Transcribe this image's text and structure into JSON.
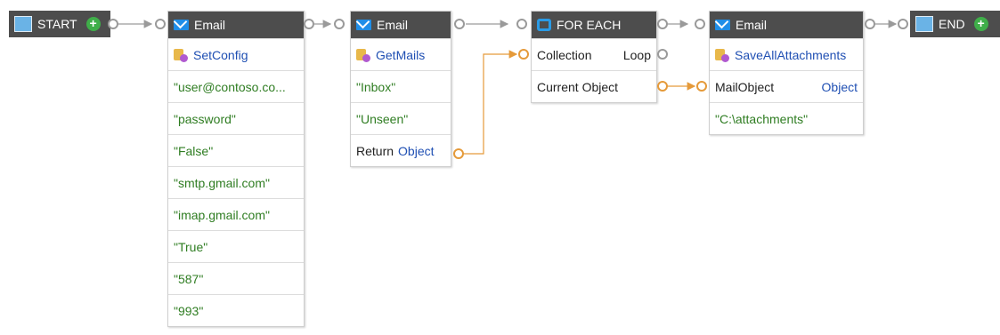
{
  "start": {
    "label": "START"
  },
  "end": {
    "label": "END"
  },
  "email1": {
    "title": "Email",
    "function": "SetConfig",
    "params": [
      "\"user@contoso.co...",
      "\"password\"",
      "\"False\"",
      "\"smtp.gmail.com\"",
      "\"imap.gmail.com\"",
      "\"True\"",
      "\"587\"",
      "\"993\""
    ]
  },
  "email2": {
    "title": "Email",
    "function": "GetMails",
    "params": [
      "\"Inbox\"",
      "\"Unseen\""
    ],
    "return_label": "Return",
    "return_type": "Object"
  },
  "foreach": {
    "title": "FOR EACH",
    "collection_label": "Collection",
    "loop_label": "Loop",
    "current_label": "Current Object"
  },
  "email3": {
    "title": "Email",
    "function": "SaveAllAttachments",
    "param_label": "MailObject",
    "param_type": "Object",
    "params": [
      "\"C:\\attachments\""
    ]
  },
  "colors": {
    "header": "#4d4d4d",
    "string": "#2f7d22",
    "link": "#1f4fb3",
    "wire": "#9a9a9a",
    "data_wire": "#e59a3a"
  }
}
